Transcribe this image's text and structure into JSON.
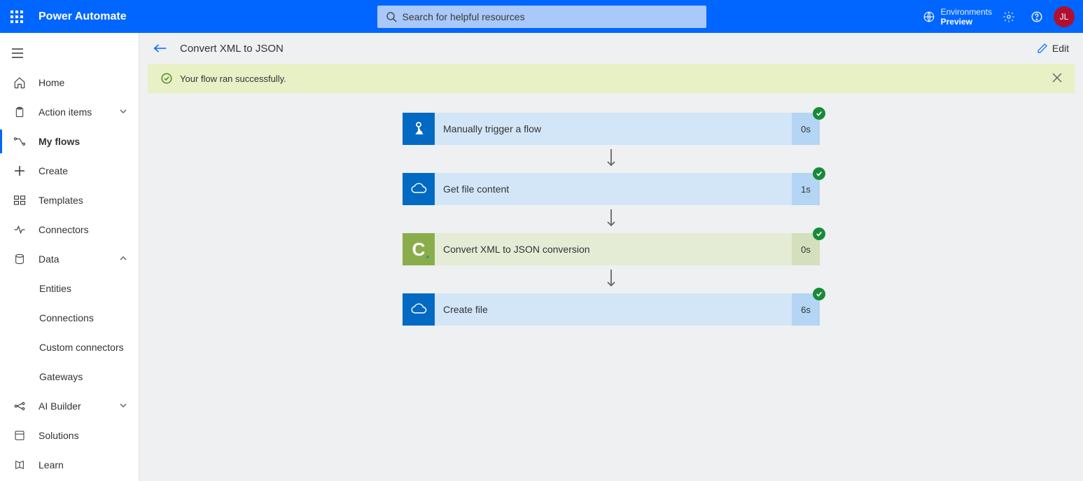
{
  "header": {
    "brand": "Power Automate",
    "search_placeholder": "Search for helpful resources",
    "env_label": "Environments",
    "env_value": "Preview",
    "avatar_initials": "JL"
  },
  "sidebar": {
    "home": "Home",
    "action_items": "Action items",
    "my_flows": "My flows",
    "create": "Create",
    "templates": "Templates",
    "connectors": "Connectors",
    "data": "Data",
    "entities": "Entities",
    "connections": "Connections",
    "custom_connectors": "Custom connectors",
    "gateways": "Gateways",
    "ai_builder": "AI Builder",
    "solutions": "Solutions",
    "learn": "Learn"
  },
  "page": {
    "title": "Convert XML to JSON",
    "edit_label": "Edit",
    "banner_text": "Your flow ran successfully."
  },
  "flow_steps": [
    {
      "label": "Manually trigger a flow",
      "duration": "0s",
      "icon": "touch",
      "theme": "blue"
    },
    {
      "label": "Get file content",
      "duration": "1s",
      "icon": "cloud",
      "theme": "blue"
    },
    {
      "label": "Convert XML to JSON conversion",
      "duration": "0s",
      "icon": "c-logo",
      "theme": "green"
    },
    {
      "label": "Create file",
      "duration": "6s",
      "icon": "cloud",
      "theme": "blue"
    }
  ]
}
